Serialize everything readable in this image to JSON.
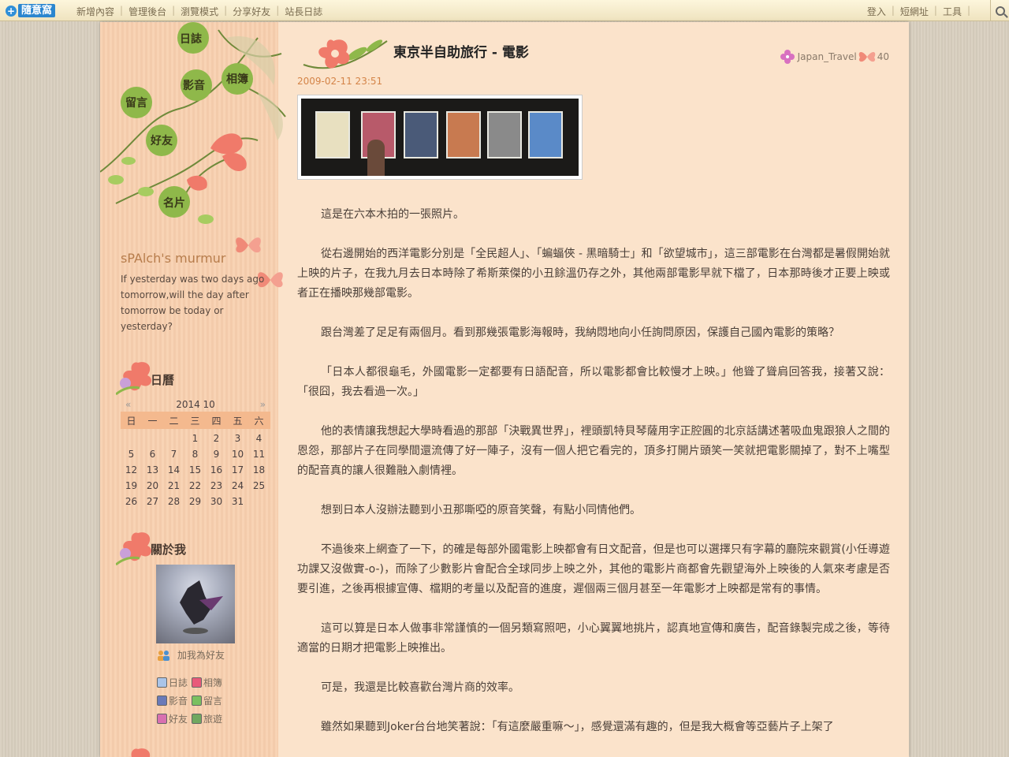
{
  "topbar": {
    "logo": "隨意窩",
    "nav": [
      "新增內容",
      "管理後台",
      "瀏覽模式",
      "分享好友",
      "站長日誌"
    ],
    "right": [
      "登入",
      "短網址",
      "工具"
    ]
  },
  "sidebar": {
    "nav": [
      "日誌",
      "影音",
      "相簿",
      "留言",
      "好友",
      "名片"
    ],
    "blog_title": "sPAlch's murmur",
    "blog_desc": "If yesterday was two days ago tomorrow,will the day after tomorrow be today or yesterday?",
    "calendar": {
      "heading": "日曆",
      "prev": "«",
      "next": "»",
      "month": "2014 10",
      "weekdays": [
        "日",
        "一",
        "二",
        "三",
        "四",
        "五",
        "六"
      ],
      "days": [
        "",
        "",
        "",
        "1",
        "2",
        "3",
        "4",
        "5",
        "6",
        "7",
        "8",
        "9",
        "10",
        "11",
        "12",
        "13",
        "14",
        "15",
        "16",
        "17",
        "18",
        "19",
        "20",
        "21",
        "22",
        "23",
        "24",
        "25",
        "26",
        "27",
        "28",
        "29",
        "30",
        "31",
        ""
      ]
    },
    "about": {
      "heading": "關於我",
      "add_friend": "加我為好友",
      "links": [
        "日誌",
        "相簿",
        "影音",
        "留言",
        "好友",
        "旅遊"
      ]
    }
  },
  "post": {
    "title": "東京半自助旅行 - 電影",
    "category": "Japan_Travel",
    "count": "40",
    "date": "2009-02-11 23:51",
    "paragraphs": [
      "這是在六本木拍的一張照片。",
      "從右邊開始的西洋電影分別是「全民超人」、「蝙蝠俠 - 黑暗騎士」和「欲望城市」，這三部電影在台灣都是暑假開始就上映的片子，在我九月去日本時除了希斯萊傑的小丑餘溫仍存之外，其他兩部電影早就下檔了，日本那時後才正要上映或者正在播映那幾部電影。",
      "跟台灣差了足足有兩個月。看到那幾張電影海報時，我納悶地向小任詢問原因，保護自己國內電影的策略？",
      "「日本人都很龜毛，外國電影一定都要有日語配音，所以電影都會比較慢才上映。」他聳了聳肩回答我，接著又說：「很囧，我去看過一次。」",
      "他的表情讓我想起大學時看過的那部「決戰異世界」，裡頭凱特貝琴薩用字正腔圓的北京話講述著吸血鬼跟狼人之間的恩怨，那部片子在同學間還流傳了好一陣子，沒有一個人把它看完的，頂多打開片頭笑一笑就把電影關掉了，對不上嘴型的配音真的讓人很難融入劇情裡。",
      "想到日本人沒辦法聽到小丑那嘶啞的原音笑聲，有點小同情他們。",
      "不過後來上網查了一下，的確是每部外國電影上映都會有日文配音，但是也可以選擇只有字幕的廳院來觀賞(小任導遊功課又沒做實-o-)，而除了少數影片會配合全球同步上映之外，其他的電影片商都會先觀望海外上映後的人氣來考慮是否要引進，之後再根據宣傳、檔期的考量以及配音的進度，遲個兩三個月甚至一年電影才上映都是常有的事情。",
      "這可以算是日本人做事非常謹慎的一個另類寫照吧，小心翼翼地挑片，認真地宣傳和廣告，配音錄製完成之後，等待適當的日期才把電影上映推出。",
      "可是，我還是比較喜歡台灣片商的效率。",
      "雖然如果聽到Joker台台地笑著說：「有這麼嚴重嘛～」，感覺還滿有趣的，但是我大概會等亞藝片子上架了"
    ]
  },
  "colors": {
    "page_bg": "#fbe3cb",
    "sidebar_bg": "#f8cfae",
    "date": "#d48448",
    "calendar_header": "#f4b98e",
    "accent_flower": "#f07a6a",
    "leaf": "#8fb84a"
  }
}
